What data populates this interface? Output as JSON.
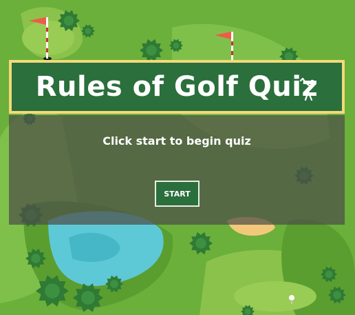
{
  "header": {
    "title": "Rules of Golf Quiz",
    "icon": "golfer-icon"
  },
  "quiz": {
    "instruction": "Click start to begin quiz",
    "start_label": "START"
  },
  "colors": {
    "fairway": "#6ab03a",
    "banner": "#2a6f3c",
    "banner_border": "#f4d97a",
    "water": "#5ec9d6",
    "sand": "#f2c97b",
    "flag": "#ef5a4a"
  }
}
